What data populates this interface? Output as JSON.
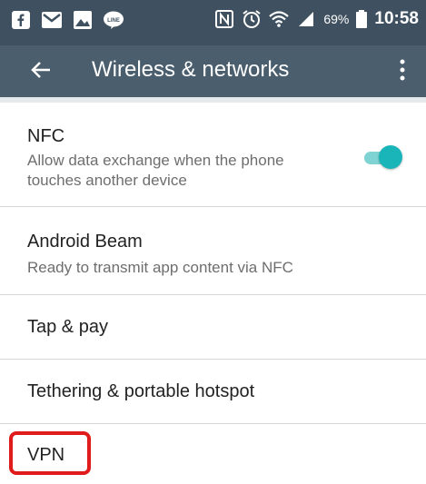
{
  "status_bar": {
    "left_icons": [
      "facebook-icon",
      "gmail-icon",
      "image-icon",
      "line-app-icon"
    ],
    "right_icons": [
      "nfc-icon",
      "alarm-icon",
      "wifi-icon",
      "signal-icon"
    ],
    "battery_percent": "69%",
    "time": "10:58"
  },
  "app_bar": {
    "title": "Wireless & networks",
    "back_icon": "arrow-left-icon",
    "more_icon": "more-vert-icon"
  },
  "settings": [
    {
      "title": "NFC",
      "subtitle": "Allow data exchange when the phone touches another device",
      "toggle": true
    },
    {
      "title": "Android Beam",
      "subtitle": "Ready to transmit app content via NFC"
    },
    {
      "title": "Tap & pay"
    },
    {
      "title": "Tethering & portable hotspot"
    },
    {
      "title": "VPN",
      "highlight_color": "#e01b1b"
    }
  ],
  "colors": {
    "status_bar": "#3f5160",
    "app_bar": "#4b5e6e",
    "toggle_on": "#1ab5b9",
    "highlight": "#e01b1b"
  }
}
